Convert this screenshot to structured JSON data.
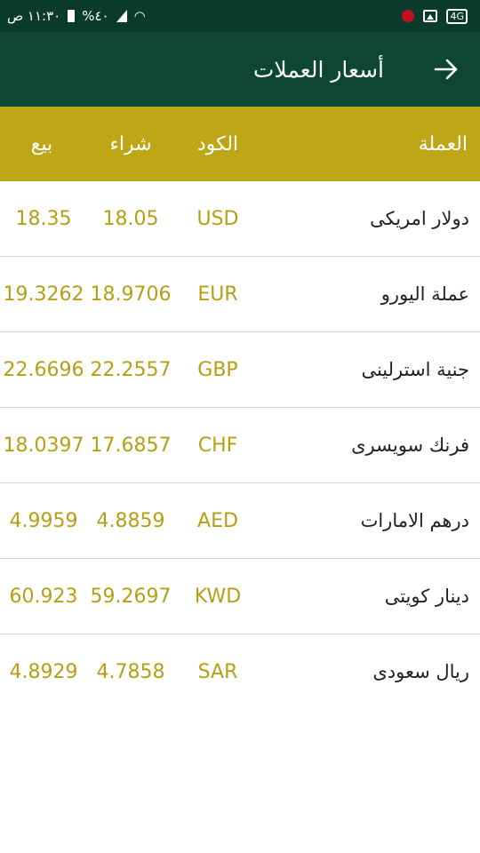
{
  "status_bar": {
    "time": "١١:٣٠ ص",
    "battery_percent": "%٤٠",
    "network": "4G",
    "record_color": "#c0121e"
  },
  "app_bar": {
    "title": "أسعار العملات",
    "back_icon": "arrow-right-icon"
  },
  "table": {
    "headers": {
      "currency": "العملة",
      "code": "الكود",
      "buy": "شراء",
      "sell": "بيع"
    },
    "rows": [
      {
        "name": "دولار امريكى",
        "code": "USD",
        "buy": "18.05",
        "sell": "18.35"
      },
      {
        "name": "عملة اليورو",
        "code": "EUR",
        "buy": "18.9706",
        "sell": "19.3262"
      },
      {
        "name": "جنية استرلينى",
        "code": "GBP",
        "buy": "22.2557",
        "sell": "22.6696"
      },
      {
        "name": "فرنك سويسرى",
        "code": "CHF",
        "buy": "17.6857",
        "sell": "18.0397"
      },
      {
        "name": "درهم الامارات",
        "code": "AED",
        "buy": "4.8859",
        "sell": "4.9959"
      },
      {
        "name": "دينار كويتى",
        "code": "KWD",
        "buy": "59.2697",
        "sell": "60.923"
      },
      {
        "name": "ريال سعودى",
        "code": "SAR",
        "buy": "4.7858",
        "sell": "4.8929"
      }
    ]
  },
  "colors": {
    "status_bar": "#0b3b2c",
    "app_bar": "#0d4632",
    "header": "#bea616",
    "value_text": "#b79e13"
  }
}
